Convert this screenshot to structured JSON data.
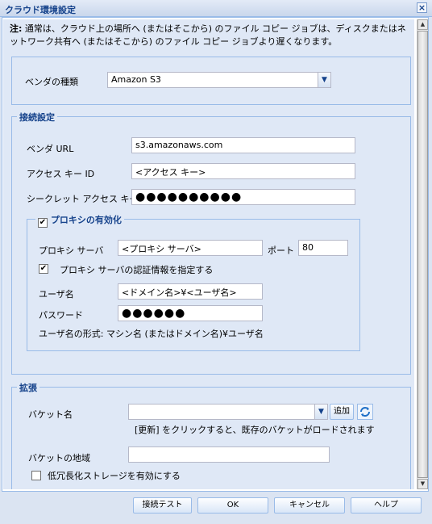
{
  "window": {
    "title": "クラウド環境設定",
    "close_glyph": "×"
  },
  "note": {
    "bold": "注:",
    "text": " 通常は、クラウド上の場所へ (またはそこから) のファイル コピー ジョブは、ディスクまたはネットワーク共有へ (またはそこから) のファイル コピー ジョブより遅くなります。"
  },
  "vendor": {
    "label": "ベンダの種類",
    "value": "Amazon S3",
    "dropdown_glyph": "▼"
  },
  "connection": {
    "legend": "接続設定",
    "vendor_url_label": "ベンダ URL",
    "vendor_url_value": "s3.amazonaws.com",
    "access_key_label": "アクセス キー ID",
    "access_key_value": "<アクセス キー>",
    "secret_key_label": "シークレット アクセス キー",
    "secret_key_value": "●●●●●●●●●●",
    "proxy": {
      "legend": "プロキシの有効化",
      "enabled": "✔",
      "server_label": "プロキシ サーバ",
      "server_value": "<プロキシ サーバ>",
      "port_label": "ポート",
      "port_value": "80",
      "auth_label": "プロキシ サーバの認証情報を指定する",
      "auth_checked": "✔",
      "username_label": "ユーザ名",
      "username_value": "<ドメイン名>¥<ユーザ名>",
      "password_label": "パスワード",
      "password_value": "●●●●●●",
      "format_hint": "ユーザ名の形式: マシン名 (またはドメイン名)¥ユーザ名"
    }
  },
  "extension": {
    "legend": "拡張",
    "bucket_label": "バケット名",
    "bucket_value": "",
    "add_button": "追加",
    "refresh_hint": "[更新] をクリックすると、既存のバケットがロードされます",
    "region_label": "バケットの地域",
    "region_value": "",
    "rrs_label": "低冗長化ストレージを有効にする"
  },
  "scrollbar": {
    "up": "▲",
    "down": "▼"
  },
  "footer": {
    "test": "接続テスト",
    "ok": "OK",
    "cancel": "キャンセル",
    "help": "ヘルプ"
  },
  "colors": {
    "accent": "#15428b",
    "panel_border": "#99bbe8",
    "background": "#dfe8f6"
  }
}
